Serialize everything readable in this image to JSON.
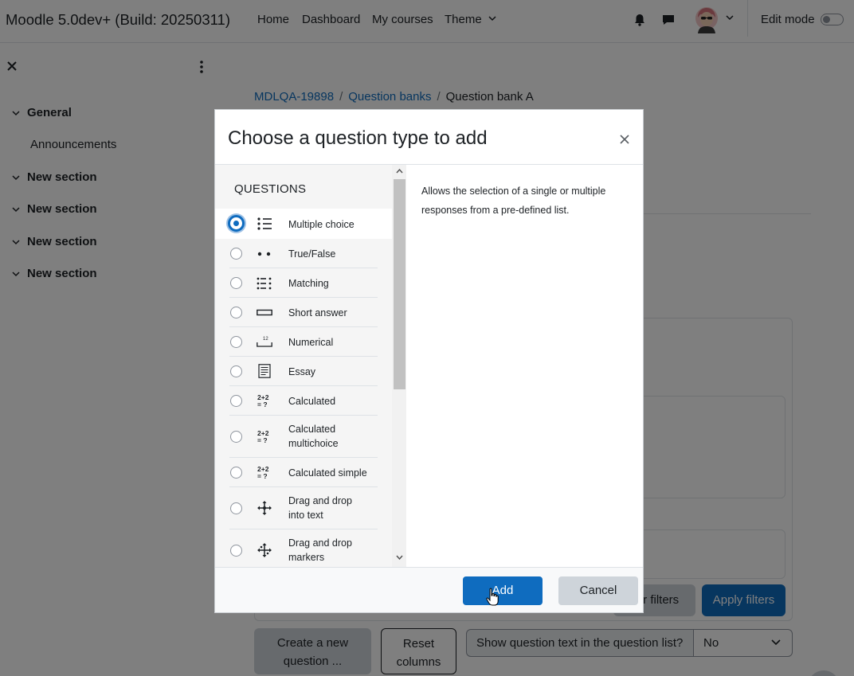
{
  "navbar": {
    "brand": "Moodle 5.0dev+ (Build: 20250311)",
    "links": [
      "Home",
      "Dashboard",
      "My courses"
    ],
    "theme_label": "Theme",
    "edit_mode_label": "Edit mode"
  },
  "course_index": {
    "sections": [
      {
        "title": "General",
        "items": [
          "Announcements"
        ]
      },
      {
        "title": "New section"
      },
      {
        "title": "New section"
      },
      {
        "title": "New section"
      },
      {
        "title": "New section"
      }
    ]
  },
  "breadcrumb": {
    "items": [
      "MDLQA-19898",
      "Question banks"
    ],
    "current": "Question bank A"
  },
  "page": {
    "clear_filters_label": "ar filters",
    "apply_filters_label": "Apply filters",
    "create_question_line1": "Create a new",
    "create_question_line2": "question ...",
    "reset_columns_line1": "Reset",
    "reset_columns_line2": "columns",
    "show_question_text_label": "Show question text in the question list?",
    "show_question_text_value": "No"
  },
  "modal": {
    "title": "Choose a question type to add",
    "list_heading": "QUESTIONS",
    "selected_index": 0,
    "question_types": [
      {
        "label": "Multiple choice",
        "icon": "list-icon"
      },
      {
        "label": "True/False",
        "icon": "dots-icon"
      },
      {
        "label": "Matching",
        "icon": "matching-icon"
      },
      {
        "label": "Short answer",
        "icon": "text-field-icon"
      },
      {
        "label": "Numerical",
        "icon": "numeric-field-icon"
      },
      {
        "label": "Essay",
        "icon": "document-icon"
      },
      {
        "label": "Calculated",
        "icon": "formula-icon"
      },
      {
        "label": "Calculated multichoice",
        "icon": "formula-icon"
      },
      {
        "label": "Calculated simple",
        "icon": "formula-icon"
      },
      {
        "label": "Drag and drop into text",
        "icon": "move-icon"
      },
      {
        "label": "Drag and drop markers",
        "icon": "move-markers-icon"
      }
    ],
    "description": "Allows the selection of a single or multiple responses from a pre-defined list.",
    "add_label": "Add",
    "cancel_label": "Cancel"
  },
  "colors": {
    "primary": "#0f6cbf",
    "secondary": "#ced4da",
    "backdrop": "rgba(0,0,0,0.5)"
  }
}
